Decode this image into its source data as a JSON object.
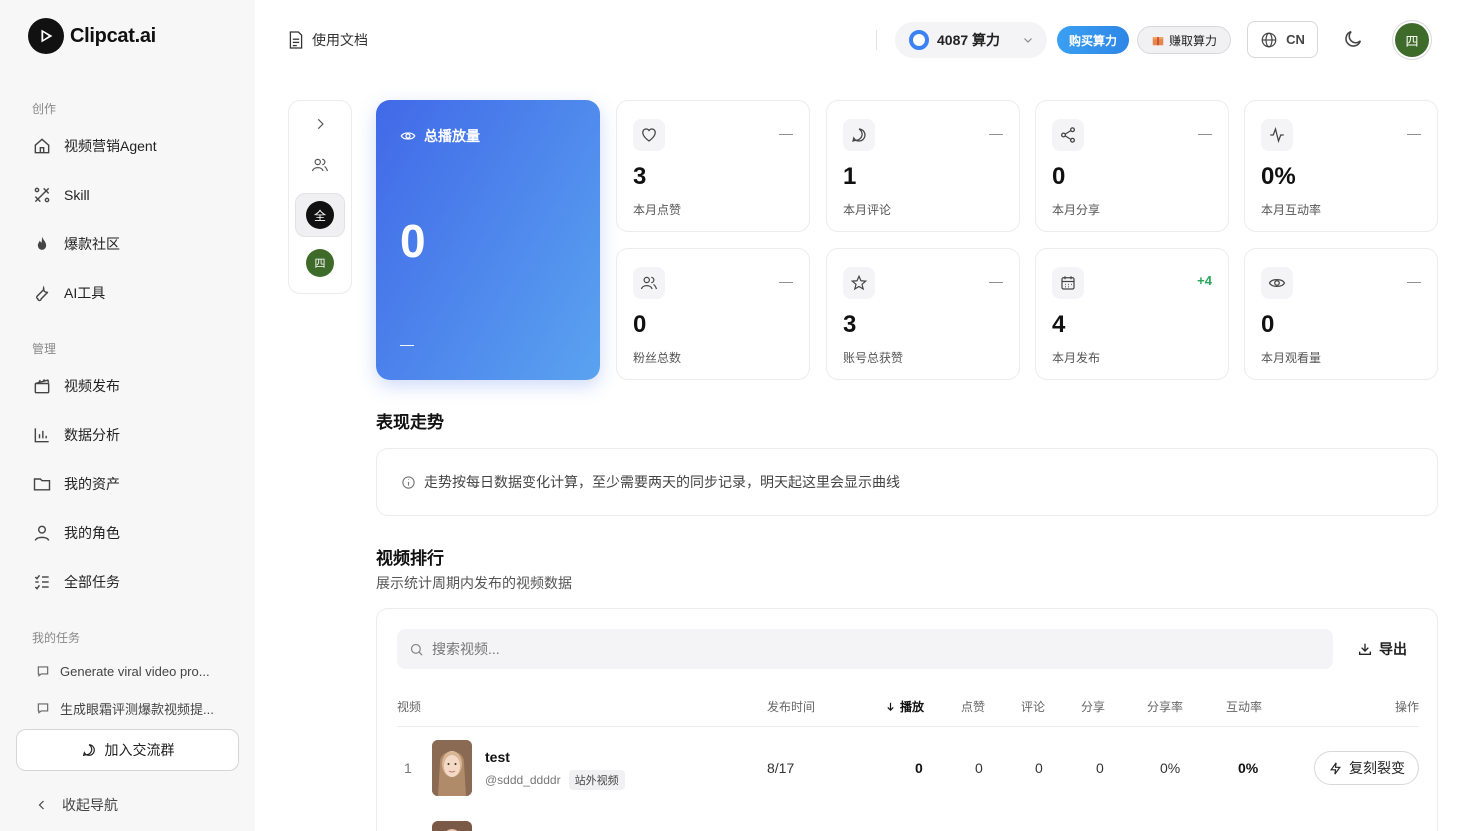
{
  "brand": {
    "name": "Clipcat.ai"
  },
  "sidebar": {
    "sections": {
      "create": "创作",
      "manage": "管理",
      "tasks": "我的任务"
    },
    "create_items": [
      {
        "label": "视频营销Agent",
        "icon": "home-icon"
      },
      {
        "label": "Skill",
        "icon": "tools-icon"
      },
      {
        "label": "爆款社区",
        "icon": "flame-icon"
      },
      {
        "label": "AI工具",
        "icon": "wrench-icon"
      }
    ],
    "manage_items": [
      {
        "label": "视频发布",
        "icon": "clapper-icon"
      },
      {
        "label": "数据分析",
        "icon": "bar-chart-icon"
      },
      {
        "label": "我的资产",
        "icon": "folder-icon"
      },
      {
        "label": "我的角色",
        "icon": "user-icon"
      },
      {
        "label": "全部任务",
        "icon": "list-check-icon"
      }
    ],
    "tasks": [
      {
        "label": "Generate viral video pro..."
      },
      {
        "label": "生成眼霜评测爆款视频提..."
      }
    ],
    "join_group": "加入交流群",
    "collapse": "收起导航"
  },
  "header": {
    "docs": "使用文档",
    "credits": "4087 算力",
    "buy": "购买算力",
    "earn": "赚取算力",
    "lang": "CN",
    "avatar": "四"
  },
  "accounts": {
    "all": "全",
    "user": "四"
  },
  "hero": {
    "label": "总播放量",
    "value": "0",
    "trend": "—"
  },
  "stats": [
    {
      "icon": "heart-icon",
      "value": "3",
      "label": "本月点赞",
      "trend": "—"
    },
    {
      "icon": "comment-icon",
      "value": "1",
      "label": "本月评论",
      "trend": "—"
    },
    {
      "icon": "share-icon",
      "value": "0",
      "label": "本月分享",
      "trend": "—"
    },
    {
      "icon": "activity-icon",
      "value": "0%",
      "label": "本月互动率",
      "trend": "—"
    },
    {
      "icon": "users-icon",
      "value": "0",
      "label": "粉丝总数",
      "trend": "—"
    },
    {
      "icon": "star-icon",
      "value": "3",
      "label": "账号总获赞",
      "trend": "—"
    },
    {
      "icon": "calendar-icon",
      "value": "4",
      "label": "本月发布",
      "trend": "+4"
    },
    {
      "icon": "eye-icon",
      "value": "0",
      "label": "本月观看量",
      "trend": "—"
    }
  ],
  "performance": {
    "title": "表现走势",
    "note": "走势按每日数据变化计算，至少需要两天的同步记录，明天起这里会显示曲线"
  },
  "ranking": {
    "title": "视频排行",
    "subtitle": "展示统计周期内发布的视频数据",
    "search_placeholder": "搜索视频...",
    "export": "导出",
    "columns": [
      "视频",
      "发布时间",
      "播放",
      "点赞",
      "评论",
      "分享",
      "分享率",
      "互动率",
      "操作"
    ],
    "rows": [
      {
        "rank": "1",
        "title": "test",
        "handle": "@sddd_ddddr",
        "tag": "站外视频",
        "date": "8/17",
        "plays": "0",
        "likes": "0",
        "comments": "0",
        "shares": "0",
        "share_rate": "0%",
        "engagement": "0%",
        "action": "复刻裂变"
      }
    ]
  }
}
